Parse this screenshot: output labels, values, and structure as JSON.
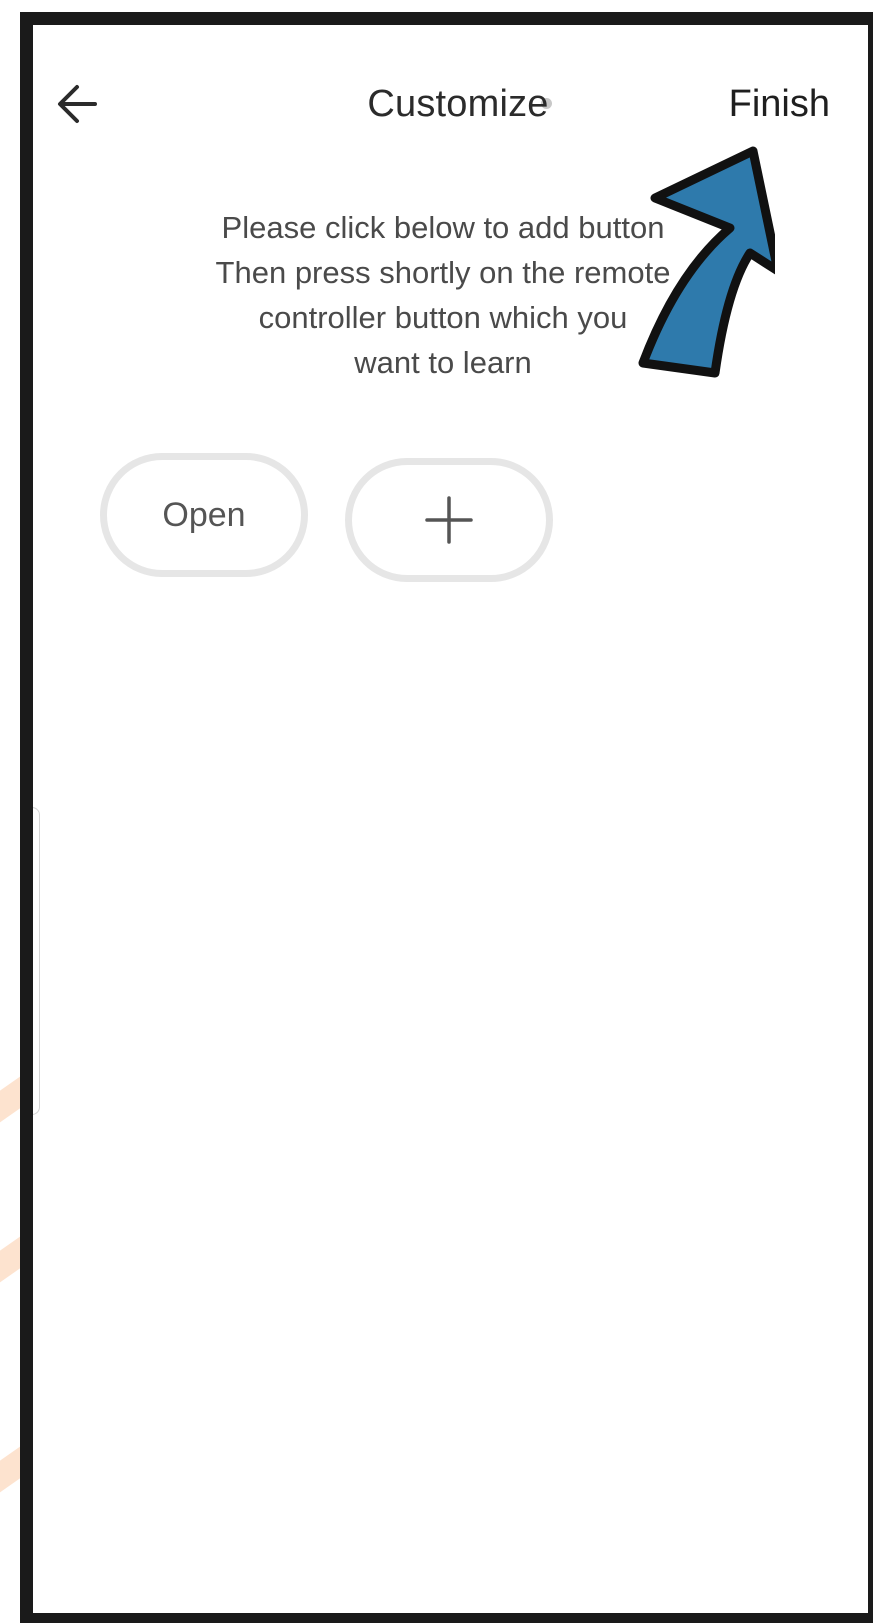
{
  "header": {
    "title": "Customize",
    "finish_label": "Finish"
  },
  "instructions": {
    "line1": "Please click below to add button",
    "line2": "Then press shortly on the remote",
    "line3": "controller button which you",
    "line4": "want to learn"
  },
  "buttons": {
    "open_label": "Open"
  },
  "colors": {
    "arrow": "#2e7aac",
    "button_border": "#e6e6e6",
    "text": "#4a4a4a"
  },
  "icons": {
    "back": "arrow-left-icon",
    "add": "plus-icon",
    "status": "status-dot"
  }
}
